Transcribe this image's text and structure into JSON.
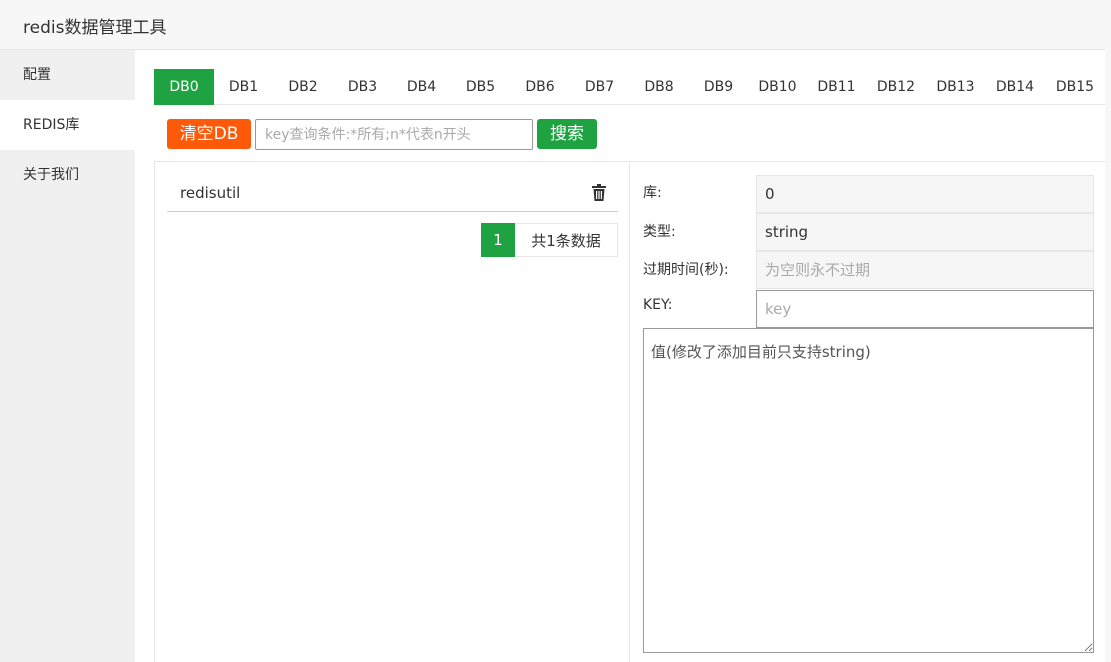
{
  "app": {
    "title": "redis数据管理工具"
  },
  "sidebar": {
    "items": [
      {
        "label": "配置"
      },
      {
        "label": "REDIS库"
      },
      {
        "label": "关于我们"
      }
    ]
  },
  "tabs": [
    "DB0",
    "DB1",
    "DB2",
    "DB3",
    "DB4",
    "DB5",
    "DB6",
    "DB7",
    "DB8",
    "DB9",
    "DB10",
    "DB11",
    "DB12",
    "DB13",
    "DB14",
    "DB15"
  ],
  "active_tab": "DB0",
  "toolbar": {
    "clear_label": "清空DB",
    "search_placeholder": "key查询条件:*所有;n*代表n开头",
    "search_label": "搜索"
  },
  "key_list": {
    "items": [
      {
        "name": "redisutil"
      }
    ],
    "pager": {
      "page": "1",
      "total": "共1条数据"
    }
  },
  "detail": {
    "db_label": "库:",
    "db_value": "0",
    "type_label": "类型:",
    "type_value": "string",
    "ttl_label": "过期时间(秒):",
    "ttl_placeholder": "为空则永不过期",
    "key_label": "KEY:",
    "key_placeholder": "key",
    "value_placeholder": "值(修改了添加目前只支持string)"
  },
  "colors": {
    "accent": "#1fa342",
    "danger": "#ff5a0a"
  }
}
